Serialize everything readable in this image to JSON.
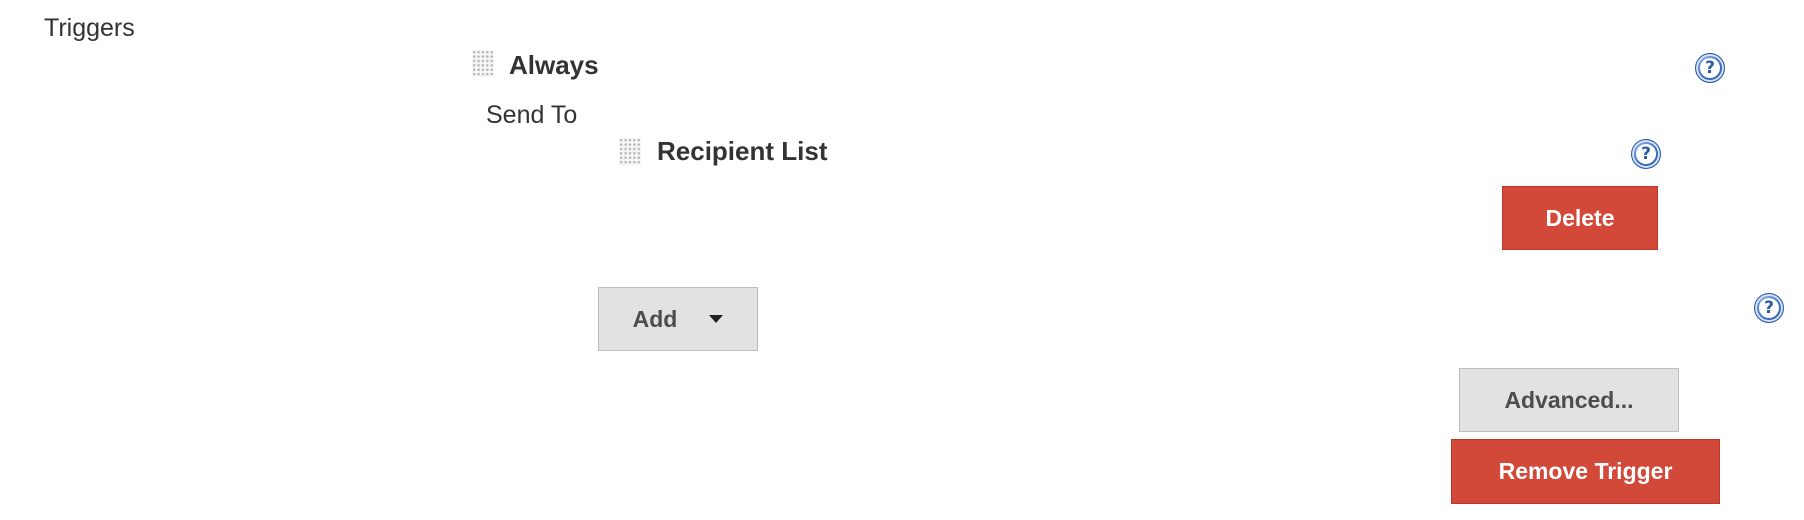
{
  "section": {
    "label": "Triggers"
  },
  "trigger": {
    "title": "Always",
    "send_to_label": "Send To",
    "recipient": {
      "title": "Recipient List",
      "delete_label": "Delete"
    },
    "add_label": "Add",
    "advanced_label": "Advanced...",
    "remove_label": "Remove Trigger"
  },
  "icons": {
    "drag": "drag-handle-icon",
    "help": "help-icon",
    "help_glyph": "?",
    "dropdown": "caret-down-icon"
  },
  "colors": {
    "danger_button": "#d24939",
    "neutral_button": "#e2e2e2",
    "help_icon": "#3f6fbf",
    "text": "#333333"
  }
}
